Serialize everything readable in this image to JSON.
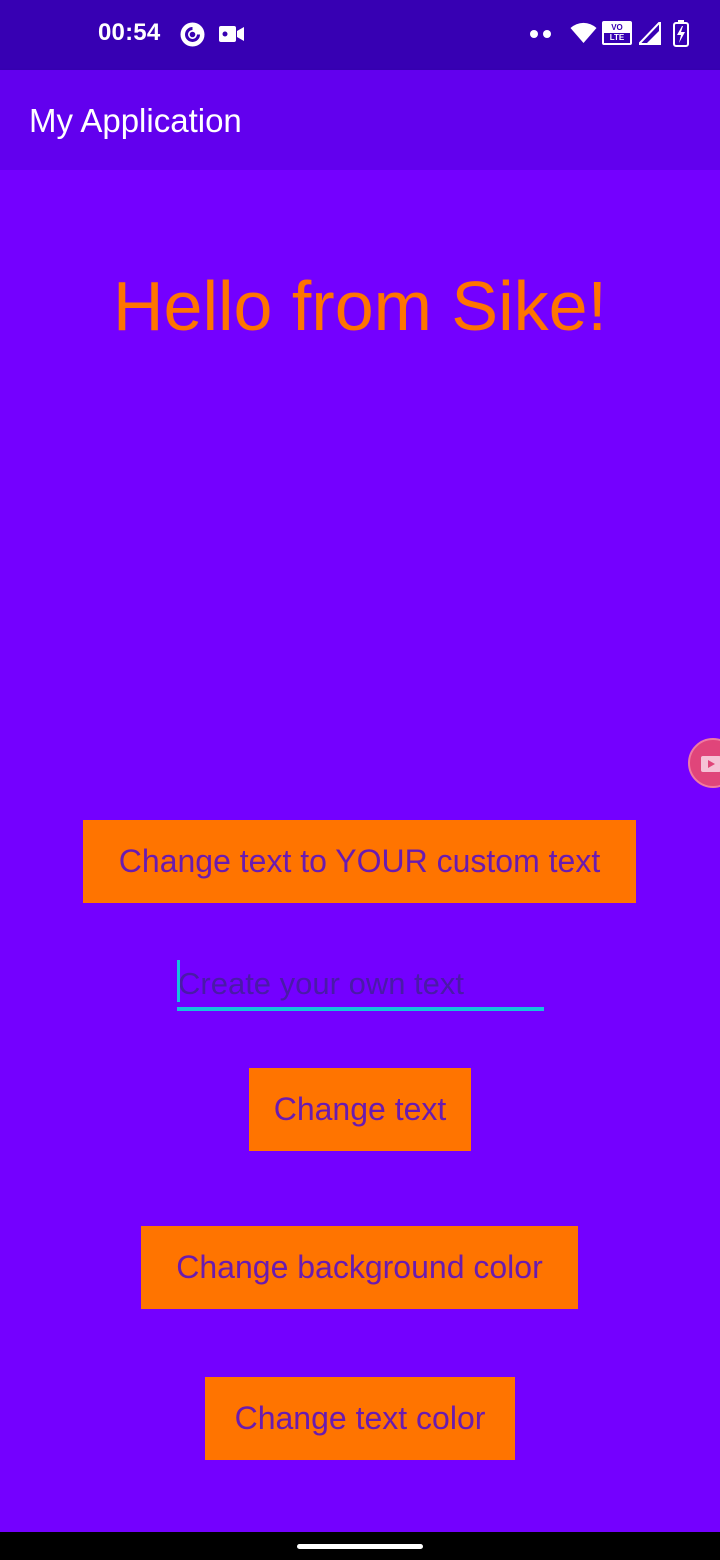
{
  "status_bar": {
    "time": "00:54",
    "volte_label_top": "VO",
    "volte_label_bottom": "LTE"
  },
  "app_bar": {
    "title": "My Application"
  },
  "main": {
    "hello_text": "Hello from Sike!",
    "custom_text_button": "Change text to YOUR custom text",
    "text_input": {
      "value": "",
      "placeholder": "Create your own text"
    },
    "change_text_button": "Change text",
    "change_bg_button": "Change background color",
    "change_text_color_button": "Change text color"
  },
  "colors": {
    "status_bar": "#3700b3",
    "app_bar": "#6200ee",
    "background": "#7400ff",
    "accent_orange": "#ff7400",
    "button_text": "#6a1bb0",
    "input_underline": "#16c2dd"
  },
  "icons": {
    "status_left": [
      "pocket-casts-icon",
      "video-camera-icon"
    ],
    "status_right": [
      "notification-dots-icon",
      "wifi-icon",
      "volte-icon",
      "signal-icon",
      "battery-charging-icon"
    ],
    "floating": "screen-recorder-icon"
  }
}
